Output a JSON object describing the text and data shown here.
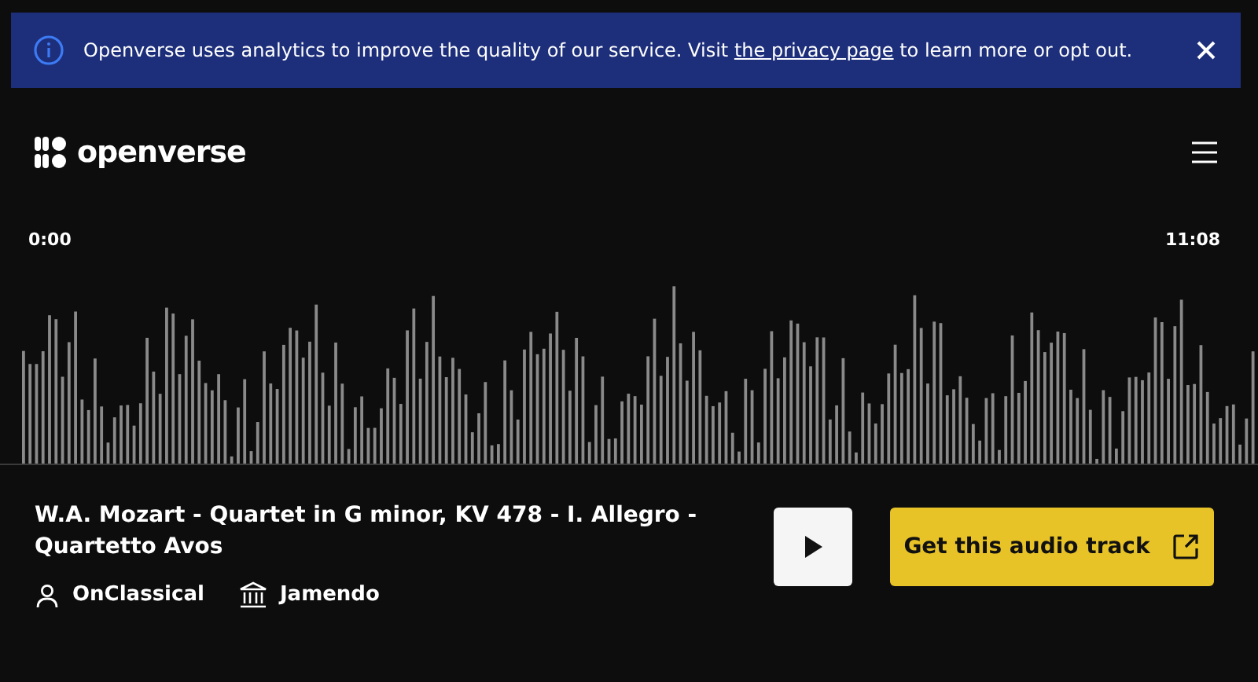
{
  "banner": {
    "text_before": "Openverse uses analytics to improve the quality of our service. Visit ",
    "link": "the privacy page",
    "text_after": " to learn more or opt out."
  },
  "header": {
    "logo_text": "openverse"
  },
  "player": {
    "start_time": "0:00",
    "end_time": "11:08"
  },
  "track": {
    "title": "W.A. Mozart - Quartet in G minor, KV 478 - I. Allegro - Quartetto Avos",
    "creator": "OnClassical",
    "source": "Jamendo",
    "action": "Get this audio track"
  }
}
